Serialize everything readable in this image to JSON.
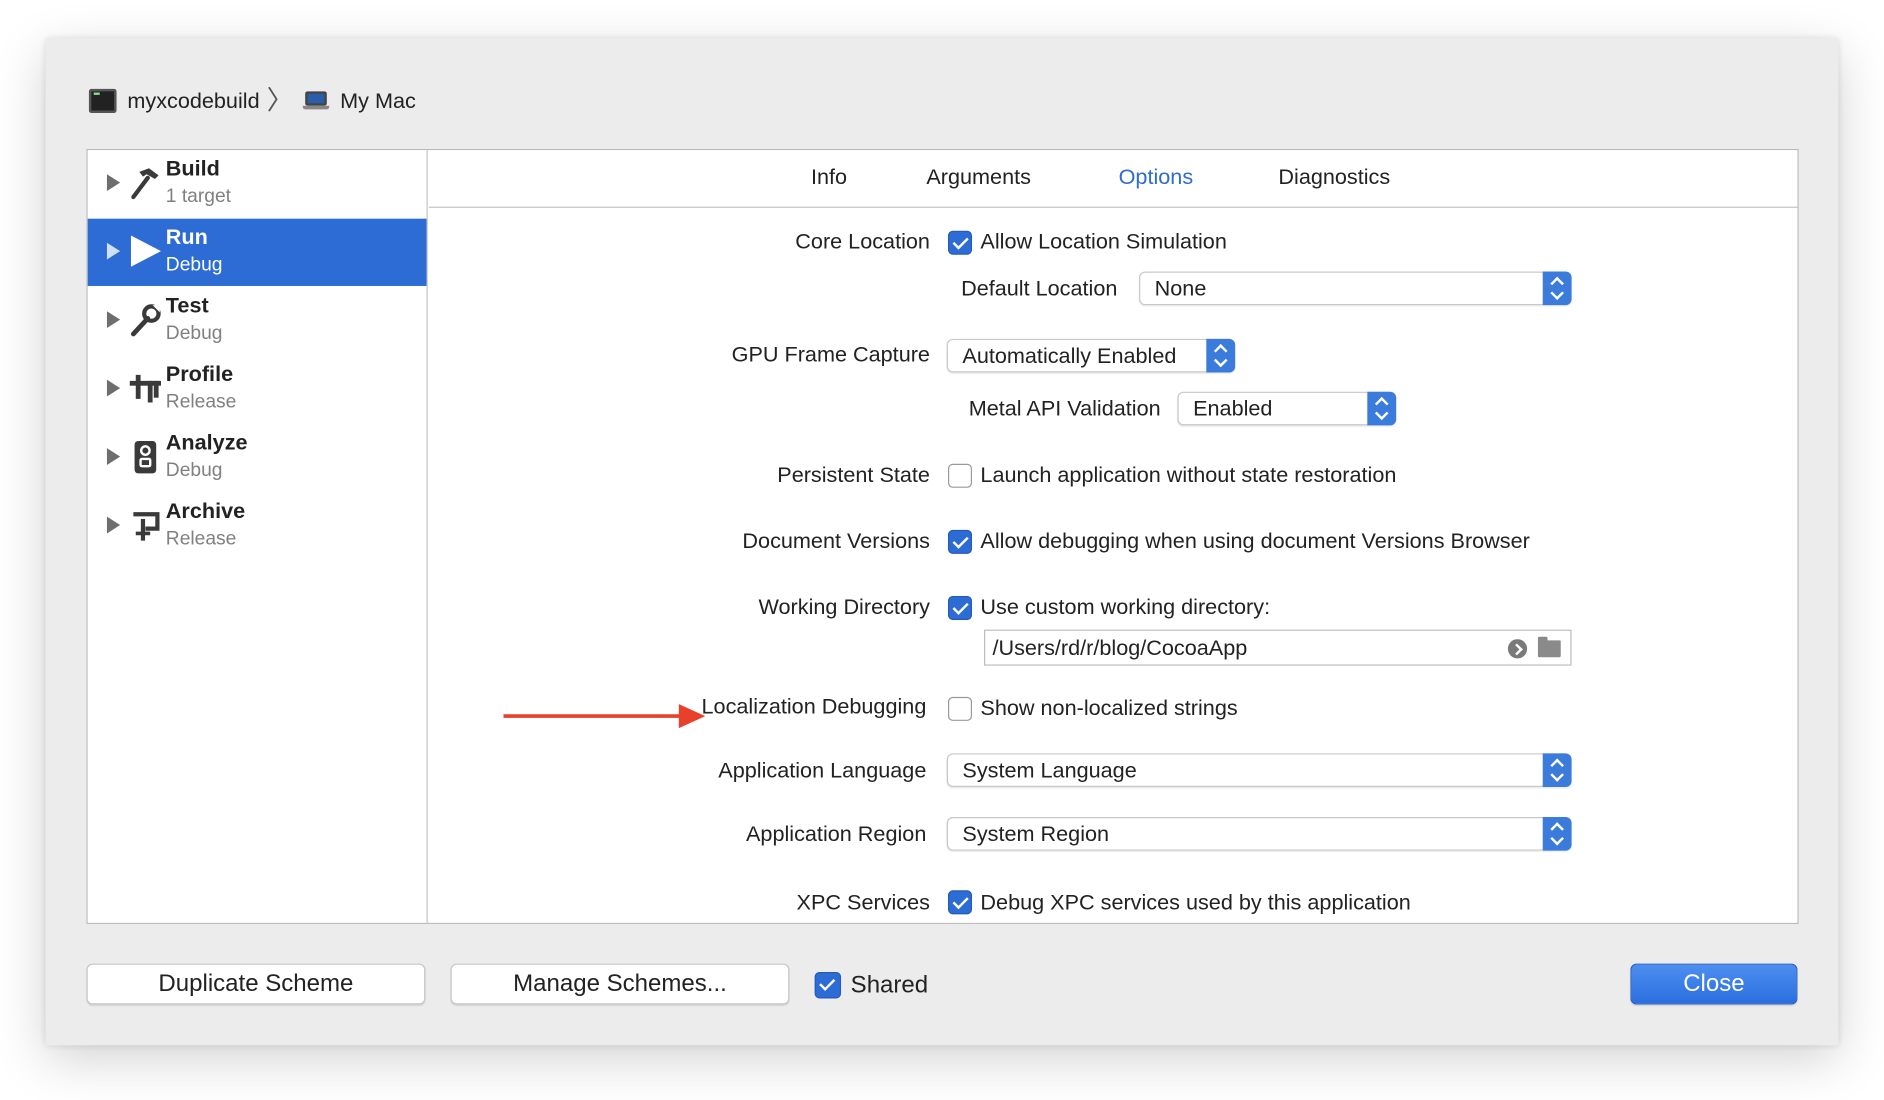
{
  "breadcrumb": {
    "project": "myxcodebuild",
    "destination": "My Mac",
    "project_icon": "terminal-icon",
    "destination_icon": "laptop-icon"
  },
  "sidebar": {
    "items": [
      {
        "name": "Build",
        "sub": "1 target",
        "icon": "hammer-icon",
        "selected": false
      },
      {
        "name": "Run",
        "sub": "Debug",
        "icon": "play-icon",
        "selected": true
      },
      {
        "name": "Test",
        "sub": "Debug",
        "icon": "wrench-icon",
        "selected": false
      },
      {
        "name": "Profile",
        "sub": "Release",
        "icon": "profile-icon",
        "selected": false
      },
      {
        "name": "Analyze",
        "sub": "Debug",
        "icon": "analyze-icon",
        "selected": false
      },
      {
        "name": "Archive",
        "sub": "Release",
        "icon": "archive-icon",
        "selected": false
      }
    ]
  },
  "tabs": [
    "Info",
    "Arguments",
    "Options",
    "Diagnostics"
  ],
  "active_tab": "Options",
  "options": {
    "core_location": {
      "label": "Core Location",
      "checkbox": "Allow Location Simulation",
      "checked": true
    },
    "default_location": {
      "label": "Default Location",
      "value": "None"
    },
    "gpu_frame_capture": {
      "label": "GPU Frame Capture",
      "value": "Automatically Enabled"
    },
    "metal_api_validation": {
      "label": "Metal API Validation",
      "value": "Enabled"
    },
    "persistent_state": {
      "label": "Persistent State",
      "checkbox": "Launch application without state restoration",
      "checked": false
    },
    "document_versions": {
      "label": "Document Versions",
      "checkbox": "Allow debugging when using document Versions Browser",
      "checked": true
    },
    "working_directory": {
      "label": "Working Directory",
      "checkbox": "Use custom working directory:",
      "checked": true,
      "path": "/Users/rd/r/blog/CocoaApp"
    },
    "localization_debugging": {
      "label": "Localization Debugging",
      "checkbox": "Show non-localized strings",
      "checked": false
    },
    "application_language": {
      "label": "Application Language",
      "value": "System Language"
    },
    "application_region": {
      "label": "Application Region",
      "value": "System Region"
    },
    "xpc_services": {
      "label": "XPC Services",
      "checkbox": "Debug XPC services used by this application",
      "checked": true
    }
  },
  "footer": {
    "duplicate": "Duplicate Scheme",
    "manage": "Manage Schemes...",
    "shared_label": "Shared",
    "shared_checked": true,
    "close": "Close"
  },
  "colors": {
    "accent": "#2c6cd4",
    "selection": "#2c6cd4",
    "annotation_arrow": "#e8402a",
    "active_tab": "#2e6cd0"
  }
}
